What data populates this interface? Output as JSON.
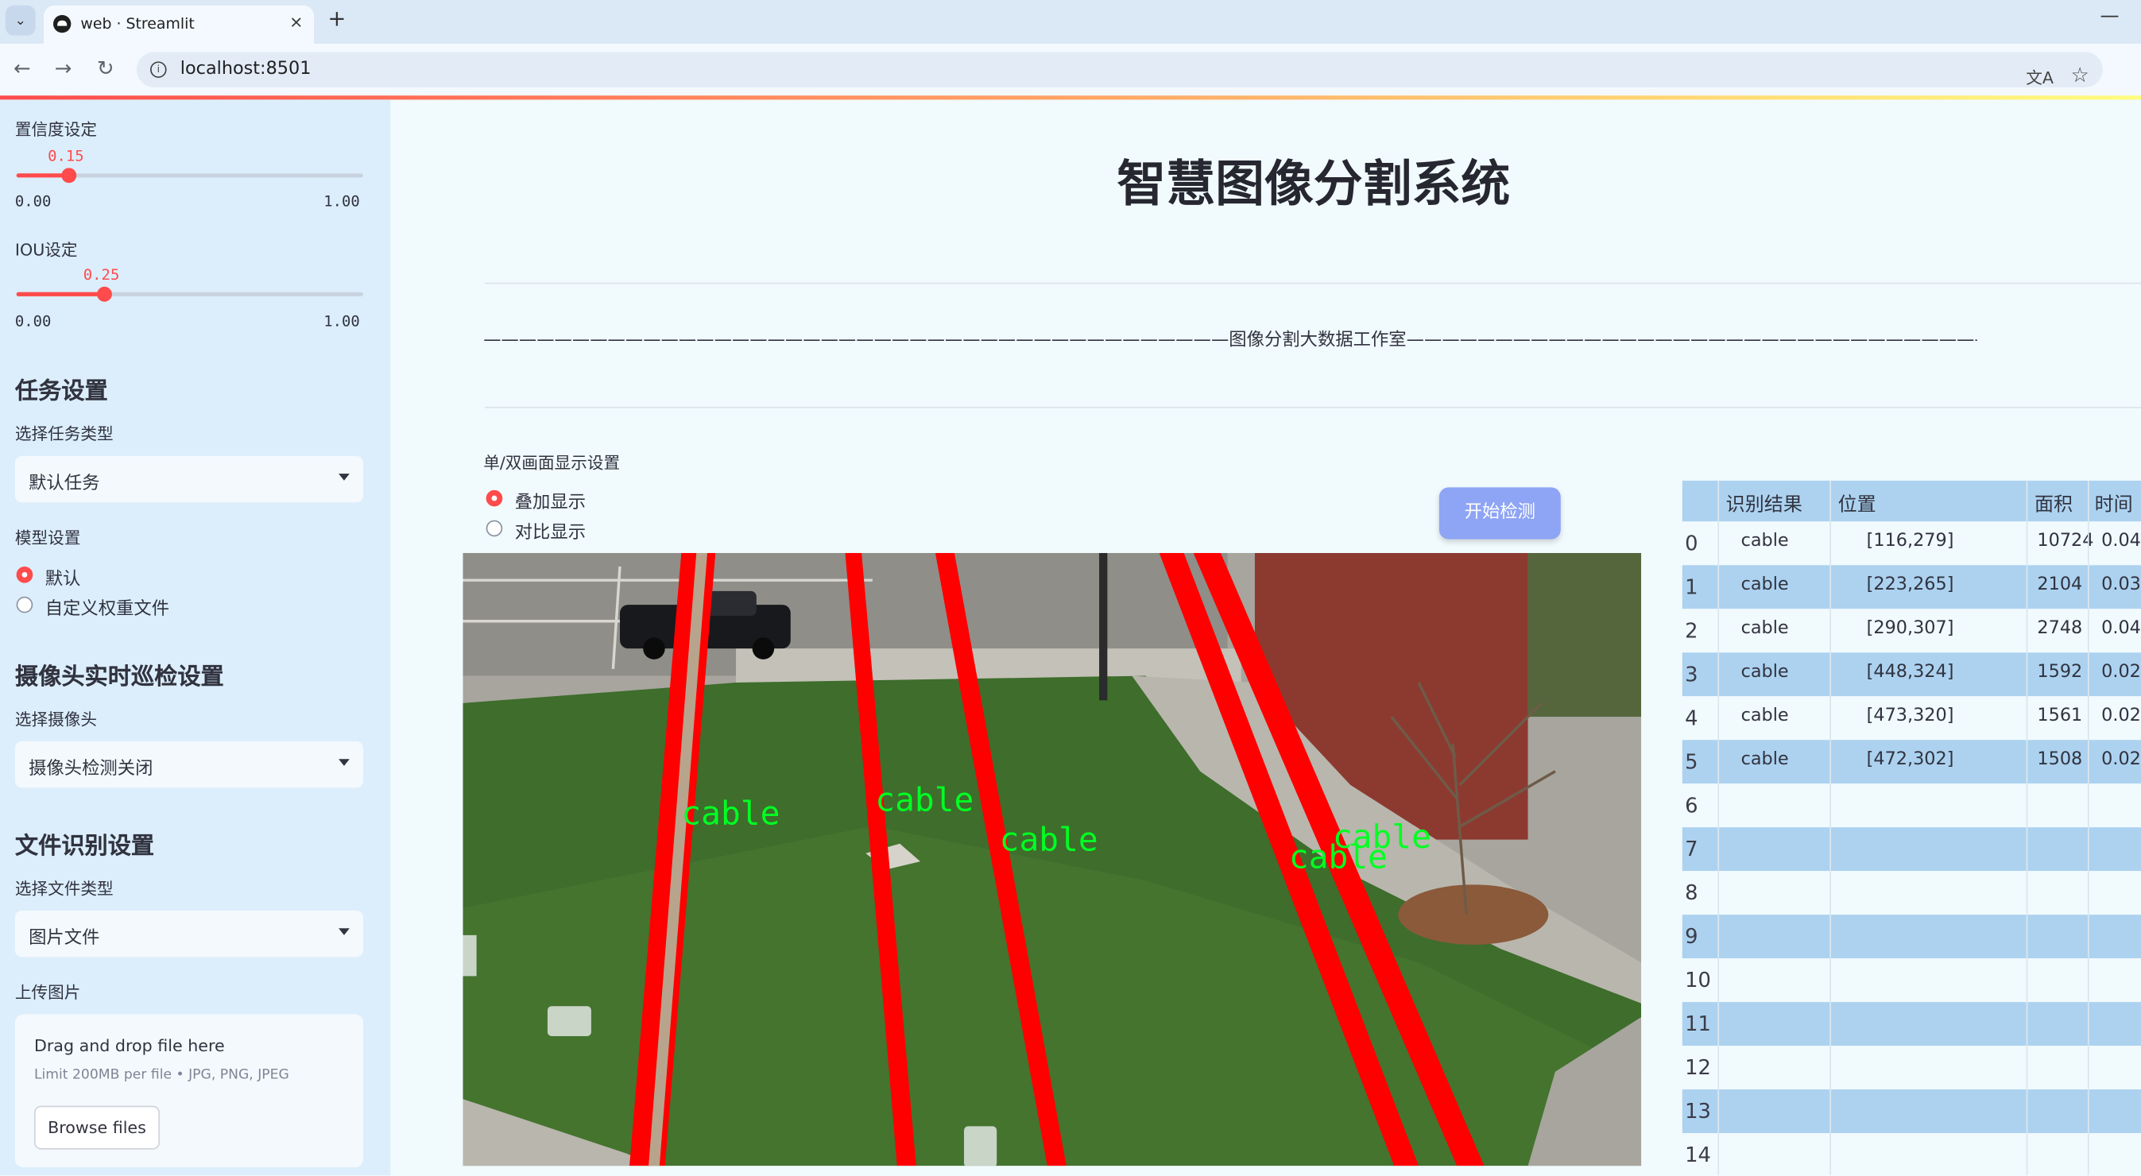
{
  "browser": {
    "tab_title": "web · Streamlit",
    "tab_close": "×",
    "new_tab": "+",
    "url": "localhost:8501",
    "window_minimize": "—"
  },
  "sidebar": {
    "confidence": {
      "label": "置信度设定",
      "value": "0.15",
      "fraction": 0.15,
      "min": "0.00",
      "max": "1.00"
    },
    "iou": {
      "label": "IOU设定",
      "value": "0.25",
      "fraction": 0.25,
      "min": "0.00",
      "max": "1.00"
    },
    "task_section": "任务设置",
    "task_type_label": "选择任务类型",
    "task_type_value": "默认任务",
    "model_label": "模型设置",
    "model_options": [
      {
        "label": "默认",
        "selected": true
      },
      {
        "label": "自定义权重文件",
        "selected": false
      }
    ],
    "camera_section": "摄像头实时巡检设置",
    "camera_label": "选择摄像头",
    "camera_value": "摄像头检测关闭",
    "file_section": "文件识别设置",
    "file_type_label": "选择文件类型",
    "file_type_value": "图片文件",
    "upload_label": "上传图片",
    "upload_title": "Drag and drop file here",
    "upload_limit": "Limit 200MB per file • JPG, PNG, JPEG",
    "browse_button": "Browse files"
  },
  "main": {
    "title": "智慧图像分割系统",
    "banner": "——————————————————————————————————————————图像分割大数据工作室——————————————————————————————————————————",
    "display_mode_label": "单/双画面显示设置",
    "display_options": [
      {
        "label": "叠加显示",
        "selected": true
      },
      {
        "label": "对比显示",
        "selected": false
      }
    ],
    "start_button": "开始检测",
    "detection_labels": [
      "cable",
      "cable",
      "cable",
      "cable",
      "cable"
    ]
  },
  "results_table": {
    "headers": [
      "识别结果",
      "位置",
      "面积",
      "时间"
    ],
    "rows": [
      {
        "index": "0",
        "label": "cable",
        "position": "[116,279]",
        "area": "10724",
        "time": "0.04"
      },
      {
        "index": "1",
        "label": "cable",
        "position": "[223,265]",
        "area": "2104",
        "time": "0.03"
      },
      {
        "index": "2",
        "label": "cable",
        "position": "[290,307]",
        "area": "2748",
        "time": "0.04"
      },
      {
        "index": "3",
        "label": "cable",
        "position": "[448,324]",
        "area": "1592",
        "time": "0.02"
      },
      {
        "index": "4",
        "label": "cable",
        "position": "[473,320]",
        "area": "1561",
        "time": "0.02"
      },
      {
        "index": "5",
        "label": "cable",
        "position": "[472,302]",
        "area": "1508",
        "time": "0.02"
      },
      {
        "index": "6",
        "label": "",
        "position": "",
        "area": "",
        "time": ""
      },
      {
        "index": "7",
        "label": "",
        "position": "",
        "area": "",
        "time": ""
      },
      {
        "index": "8",
        "label": "",
        "position": "",
        "area": "",
        "time": ""
      },
      {
        "index": "9",
        "label": "",
        "position": "",
        "area": "",
        "time": ""
      },
      {
        "index": "10",
        "label": "",
        "position": "",
        "area": "",
        "time": ""
      },
      {
        "index": "11",
        "label": "",
        "position": "",
        "area": "",
        "time": ""
      },
      {
        "index": "12",
        "label": "",
        "position": "",
        "area": "",
        "time": ""
      },
      {
        "index": "13",
        "label": "",
        "position": "",
        "area": "",
        "time": ""
      },
      {
        "index": "14",
        "label": "",
        "position": "",
        "area": "",
        "time": ""
      }
    ]
  },
  "colors": {
    "accent": "#ff4b4b",
    "sidebar_bg": "#dceefc",
    "table_stripe": "#acd2f0",
    "button_bg": "#8ea4f5",
    "mask_red": "#ff0000",
    "label_green": "#00ff22"
  }
}
